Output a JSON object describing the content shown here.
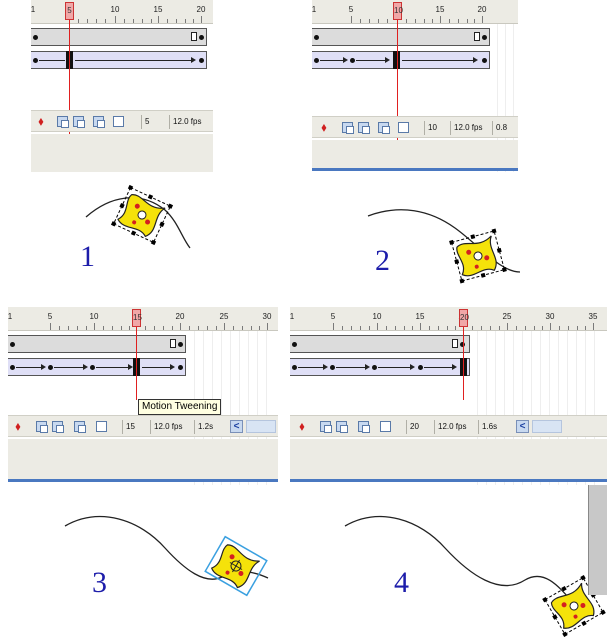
{
  "panels": [
    {
      "id": "panel-1",
      "ruler_labels": [
        "1",
        "5",
        "10",
        "15",
        "20"
      ],
      "playhead_frame": "5",
      "status": {
        "frame": "5",
        "fps": "12.0 fps"
      },
      "step_label": "1"
    },
    {
      "id": "panel-2",
      "ruler_labels": [
        "1",
        "5",
        "10",
        "15",
        "20"
      ],
      "playhead_frame": "10",
      "status": {
        "frame": "10",
        "fps": "12.0 fps",
        "time": "0.8"
      },
      "step_label": "2"
    },
    {
      "id": "panel-3",
      "ruler_labels": [
        "1",
        "5",
        "10",
        "15",
        "20",
        "25",
        "30"
      ],
      "playhead_frame": "15",
      "status": {
        "frame": "15",
        "fps": "12.0 fps",
        "time": "1.2s"
      },
      "tooltip": "Motion Tweening",
      "step_label": "3"
    },
    {
      "id": "panel-4",
      "ruler_labels": [
        "1",
        "5",
        "10",
        "15",
        "20",
        "25",
        "30",
        "35"
      ],
      "playhead_frame": "20",
      "status": {
        "frame": "20",
        "fps": "12.0 fps",
        "time": "1.6s"
      },
      "step_label": "4"
    }
  ],
  "icons": {
    "add_layer": "red-pin-icon",
    "onion_skin": "onion-skin-icon",
    "onion_outline": "onion-skin-outline-icon",
    "edit_multiple": "edit-multiple-frames-icon",
    "onion_markers": "onion-markers-icon",
    "scroll_left": "scroll-left-icon"
  },
  "colors": {
    "step_number": "#1d1daa",
    "playhead": "#e02020",
    "motion_tween_span": "#dfdff6",
    "selection_box": "#3aa0e0",
    "symbol_fill": "#f5e20a",
    "symbol_dots": "#d42020"
  }
}
